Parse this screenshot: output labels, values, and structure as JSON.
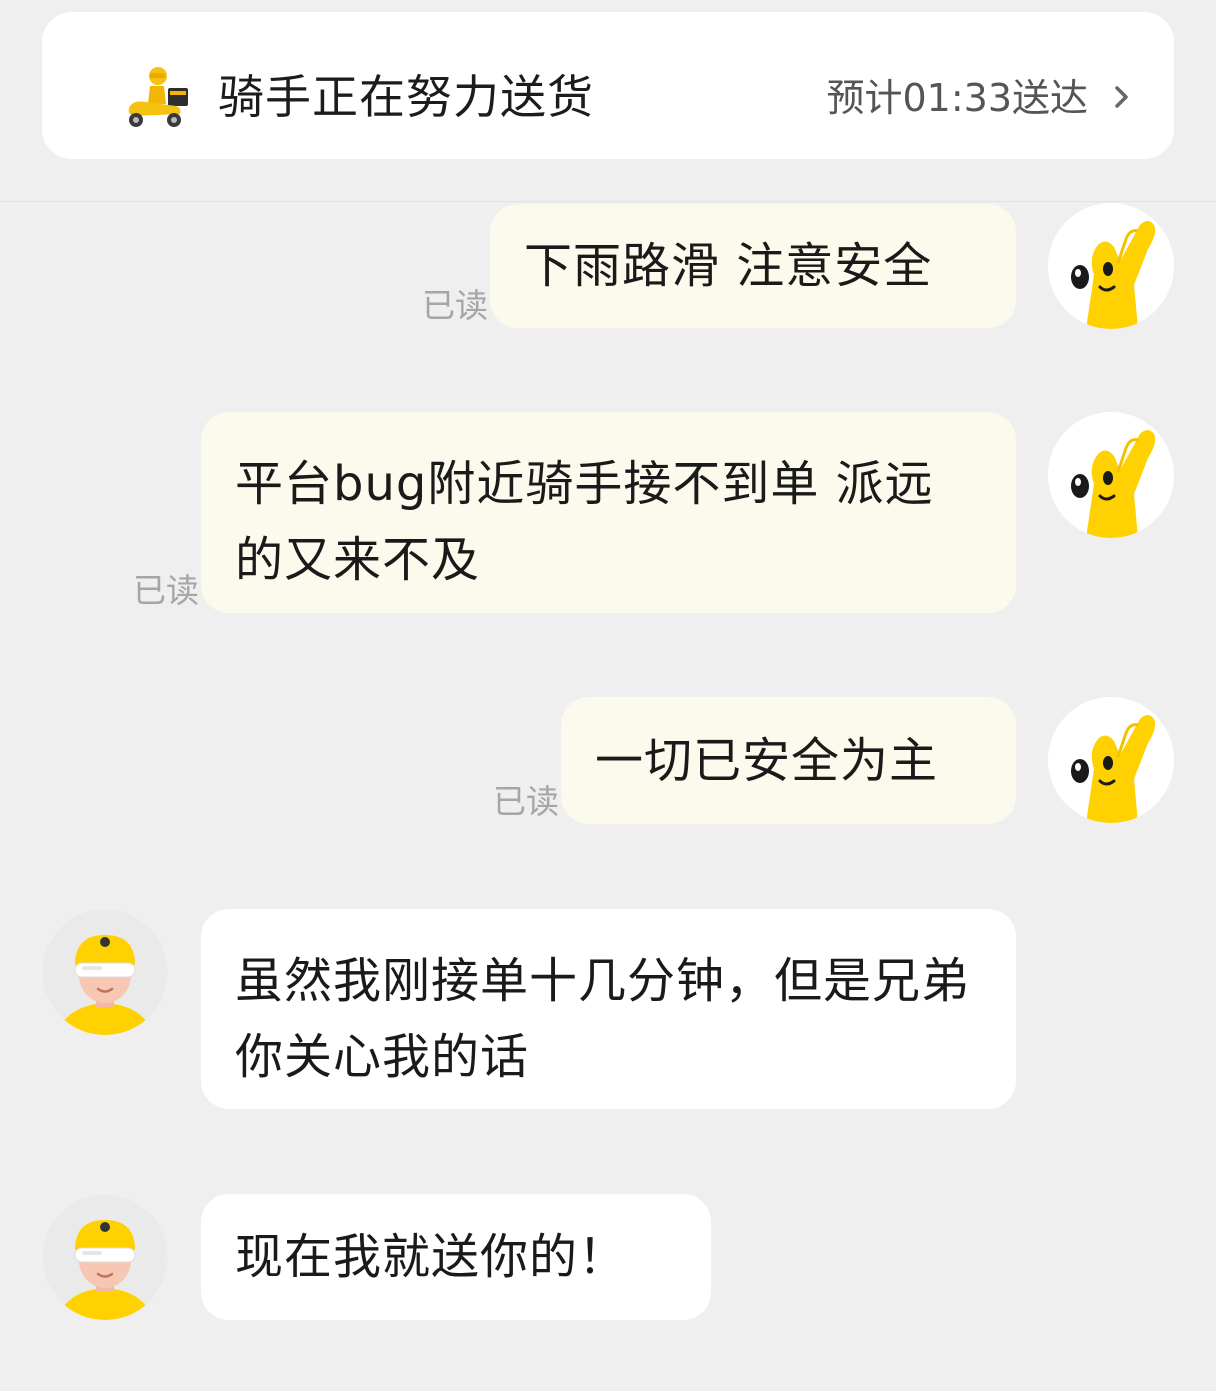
{
  "status": {
    "title": "骑手正在努力送货",
    "eta": "预计01:33送达",
    "rider_icon": "rider-scooter-icon",
    "chevron_icon": "chevron-right-icon"
  },
  "messages": [
    {
      "from": "me",
      "text": "下雨路滑 注意安全",
      "read_label": "已读",
      "avatar": "hand-mascot-icon"
    },
    {
      "from": "me",
      "text": "平台bug附近骑手接不到单 派远的又来不及",
      "read_label": "已读",
      "avatar": "hand-mascot-icon"
    },
    {
      "from": "me",
      "text": "一切已安全为主",
      "read_label": "已读",
      "avatar": "hand-mascot-icon"
    },
    {
      "from": "rider",
      "text": "虽然我刚接单十几分钟，但是兄弟你关心我的话",
      "avatar": "rider-avatar-icon"
    },
    {
      "from": "rider",
      "text": "现在我就送你的！",
      "avatar": "rider-avatar-icon"
    }
  ],
  "colors": {
    "background": "#efefef",
    "my_bubble": "#fcfaec",
    "rider_bubble": "#ffffff",
    "read_text": "#a6a6a6",
    "brand_yellow": "#ffd100"
  }
}
